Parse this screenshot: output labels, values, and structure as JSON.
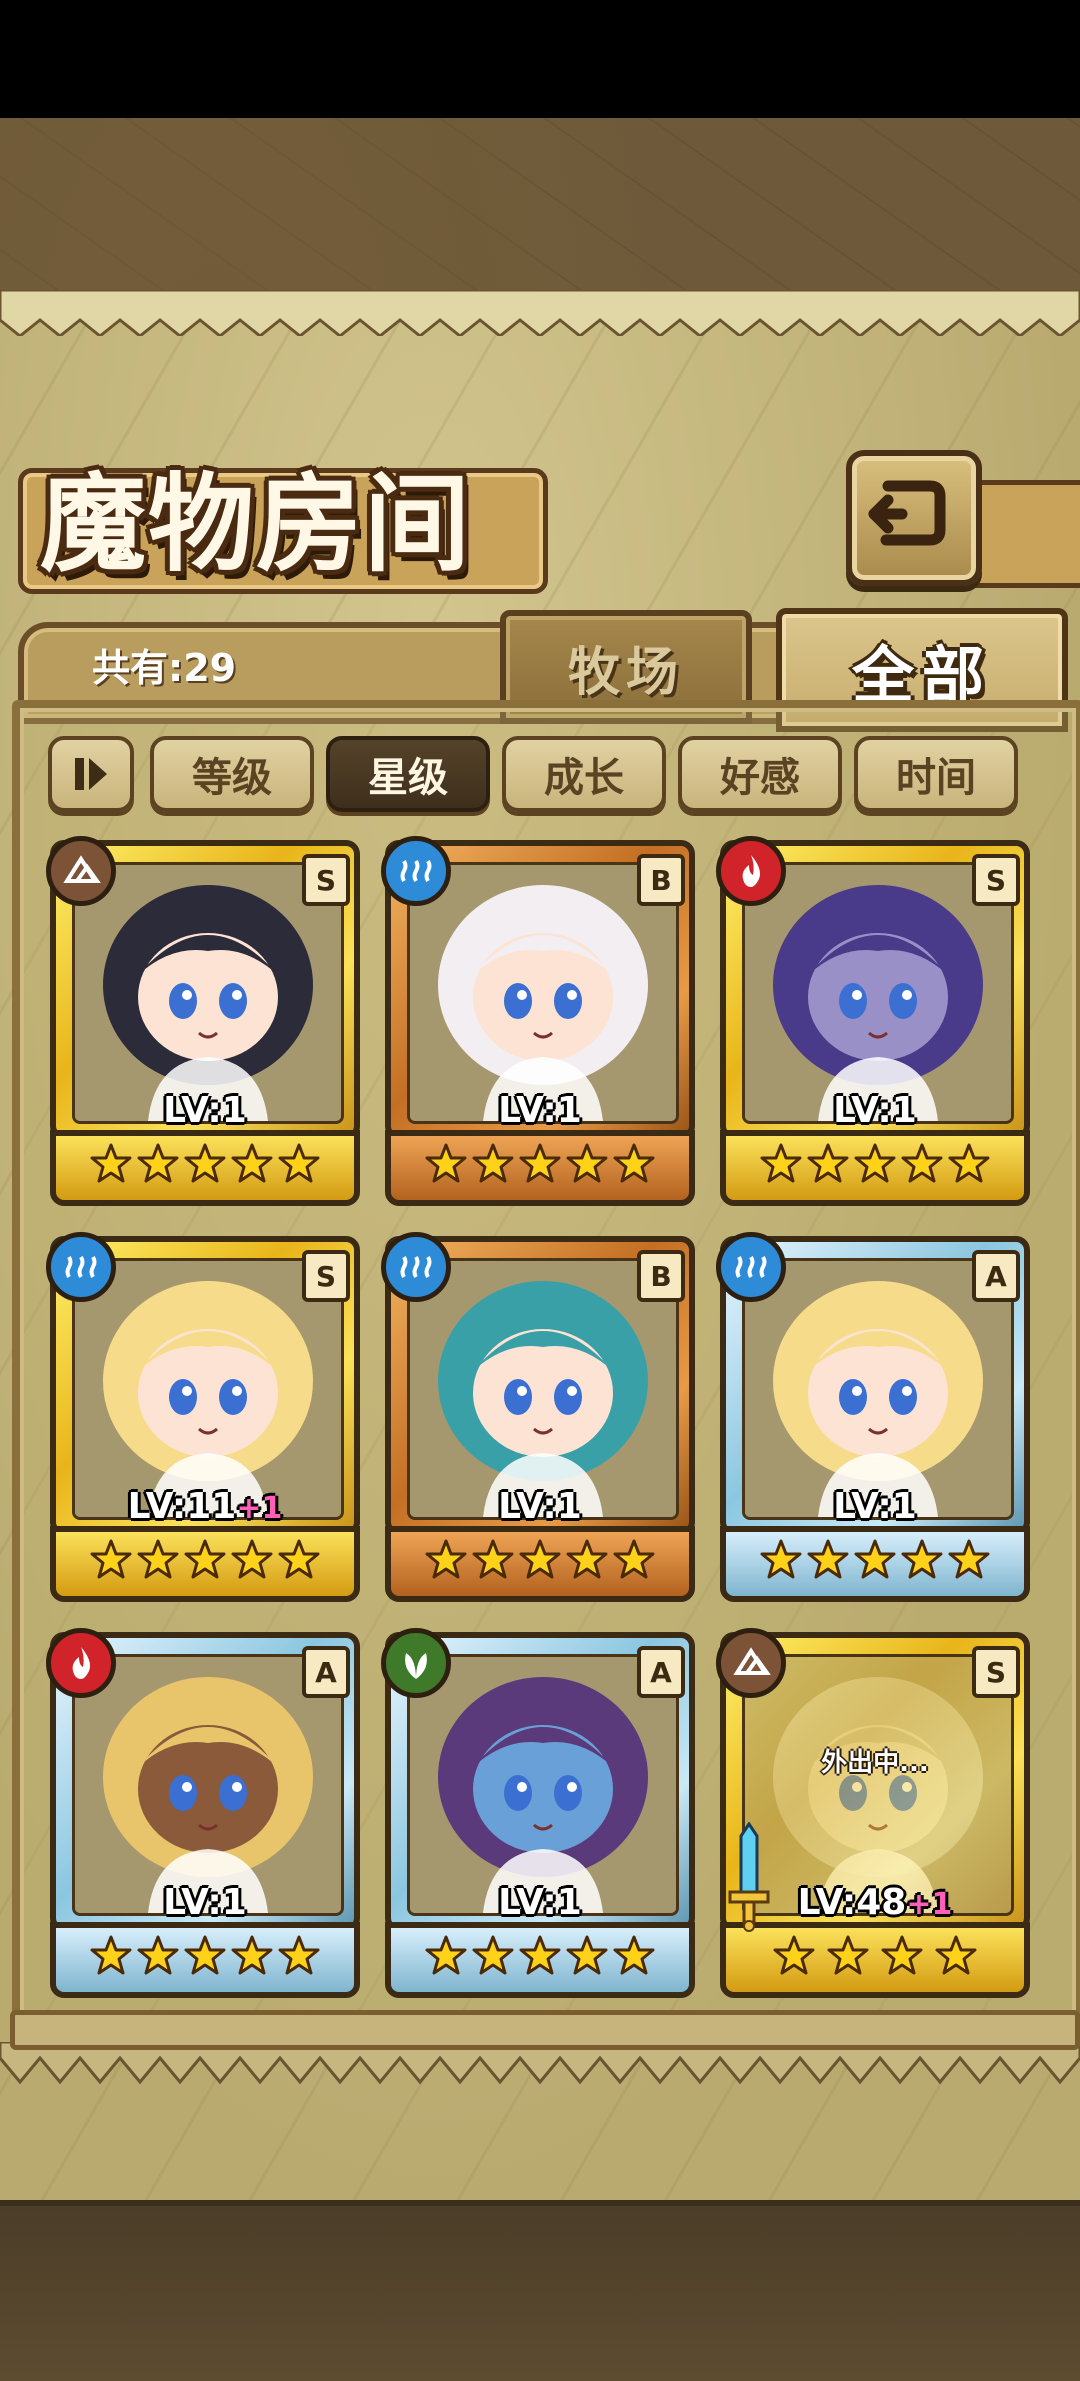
{
  "header": {
    "title": "魔物房间",
    "back_icon": "return-arrow-icon"
  },
  "summary": {
    "count_label": "共有:29"
  },
  "tabs": [
    {
      "label": "牧场",
      "active": false
    },
    {
      "label": "全部",
      "active": true
    }
  ],
  "sort_bar": {
    "toggle_icon": "sort-direction-icon",
    "buttons": [
      {
        "label": "等级",
        "active": false
      },
      {
        "label": "星级",
        "active": true
      },
      {
        "label": "成长",
        "active": false
      },
      {
        "label": "好感",
        "active": false
      },
      {
        "label": "时间",
        "active": false
      }
    ]
  },
  "monsters": [
    {
      "rank": "S",
      "element": "earth",
      "frame": "gold",
      "level": "LV:1",
      "bonus": "",
      "stars": 5,
      "status": "",
      "hair": "#2b2b3a",
      "skin": "#fde3d3"
    },
    {
      "rank": "B",
      "element": "water",
      "frame": "bronze",
      "level": "LV:1",
      "bonus": "",
      "stars": 5,
      "status": "",
      "hair": "#f2eef2",
      "skin": "#fde3d3"
    },
    {
      "rank": "S",
      "element": "fire",
      "frame": "gold",
      "level": "LV:1",
      "bonus": "",
      "stars": 5,
      "status": "",
      "hair": "#4a3a8a",
      "skin": "#9a90c8"
    },
    {
      "rank": "S",
      "element": "water",
      "frame": "gold",
      "level": "LV:11",
      "bonus": "+1",
      "stars": 5,
      "status": "",
      "hair": "#f6dc8a",
      "skin": "#fde3d3"
    },
    {
      "rank": "B",
      "element": "water",
      "frame": "bronze",
      "level": "LV:1",
      "bonus": "",
      "stars": 5,
      "status": "",
      "hair": "#3aa0a8",
      "skin": "#fde3d3"
    },
    {
      "rank": "A",
      "element": "water",
      "frame": "silver",
      "level": "LV:1",
      "bonus": "",
      "stars": 5,
      "status": "",
      "hair": "#f6dc8a",
      "skin": "#fde3d3"
    },
    {
      "rank": "A",
      "element": "fire",
      "frame": "silver",
      "level": "LV:1",
      "bonus": "",
      "stars": 5,
      "status": "",
      "hair": "#e8c56a",
      "skin": "#8a5a3a"
    },
    {
      "rank": "A",
      "element": "wood",
      "frame": "silver",
      "level": "LV:1",
      "bonus": "",
      "stars": 5,
      "status": "",
      "hair": "#5a3a7a",
      "skin": "#6aa0d8"
    },
    {
      "rank": "S",
      "element": "earth",
      "frame": "gold",
      "level": "LV:48",
      "bonus": "+1",
      "stars": 4,
      "status": "外出中...",
      "hair": "#c9c3a8",
      "skin": "#e6e0c8"
    }
  ]
}
